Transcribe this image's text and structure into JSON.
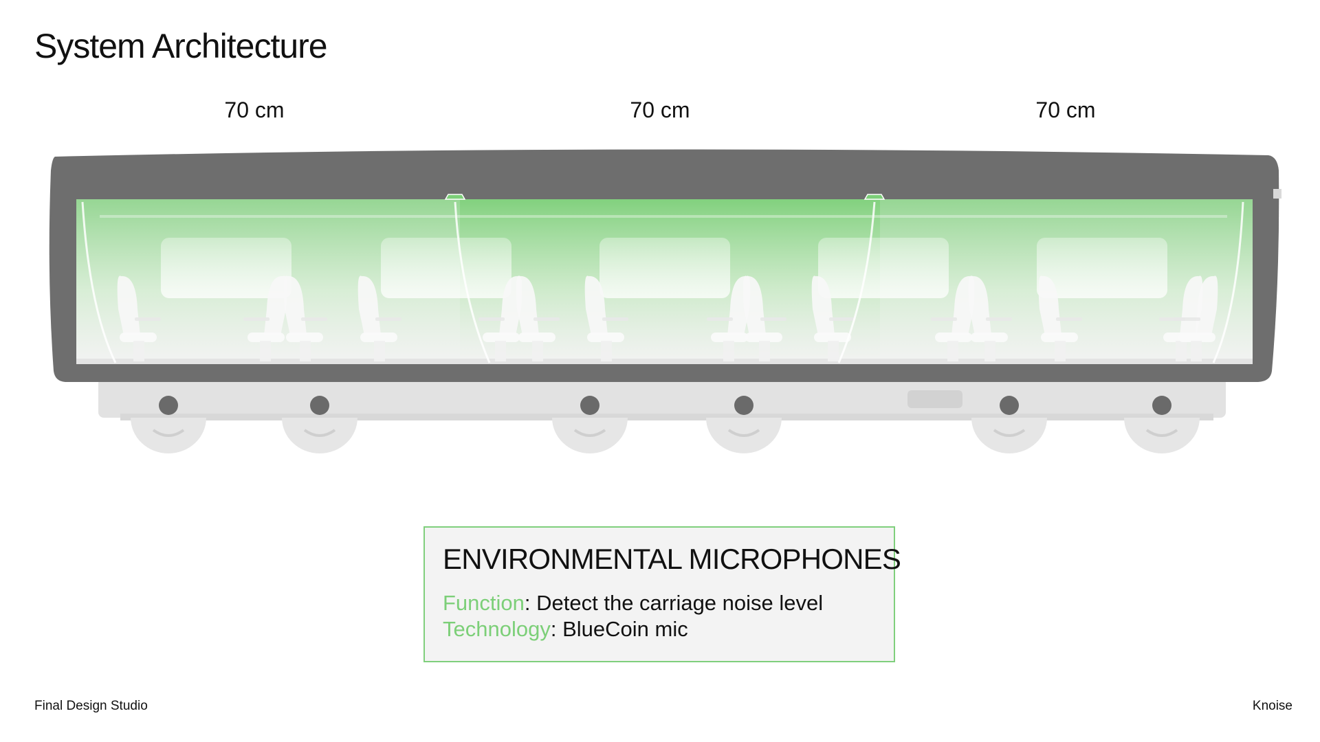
{
  "slide": {
    "title": "System Architecture",
    "footer_left": "Final Design Studio",
    "footer_right": "Knoise"
  },
  "dimensions": [
    "70 cm",
    "70 cm",
    "70 cm"
  ],
  "info_box": {
    "heading": "ENVIRONMENTAL MICROPHONES",
    "rows": [
      {
        "label": "Function",
        "sep": ": ",
        "value": "Detect the carriage noise level"
      },
      {
        "label": "Technology",
        "sep": ": ",
        "value": "BlueCoin mic"
      }
    ]
  },
  "colors": {
    "accent": "#7ccf78",
    "box_border": "#7fcf7c",
    "carriage_shell": "#6e6e6e",
    "zone_green": "#86d183"
  },
  "diagram": {
    "icons": [
      "train-carriage",
      "microphone-sensor",
      "passenger-seat",
      "wheel",
      "window"
    ]
  }
}
